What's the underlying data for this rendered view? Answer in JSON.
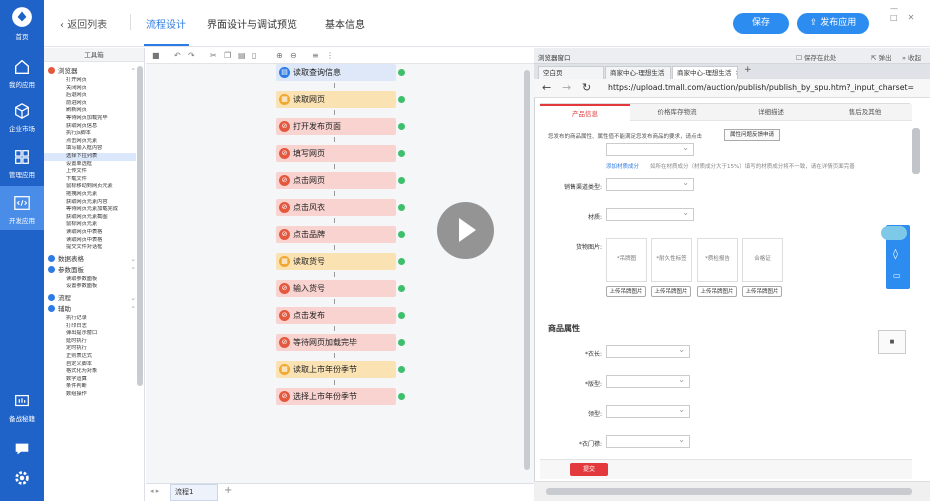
{
  "nav": {
    "home_label": "首页",
    "items": [
      {
        "label": "我的应用",
        "icon": "house-icon"
      },
      {
        "label": "企业市场",
        "icon": "cube-icon"
      },
      {
        "label": "管理应用",
        "icon": "grid-icon"
      },
      {
        "label": "开发应用",
        "icon": "code-icon",
        "active": true
      }
    ],
    "bottom_label": "备战秘籍",
    "chat_icon": "chat-icon",
    "settings_icon": "gear-icon",
    "colors": {
      "bg": "#1f62c8",
      "active": "#4a8de8"
    }
  },
  "header": {
    "back_label": "返回列表",
    "tabs": [
      "流程设计",
      "界面设计与调试预览",
      "基本信息"
    ],
    "save_label": "保存",
    "publish_label": "发布应用",
    "window_controls": [
      "—",
      "□",
      "✕"
    ],
    "accent": "#2d8cf0"
  },
  "toolbox": {
    "title": "工具箱",
    "groups": [
      {
        "name": "浏览器",
        "color": "#e4583e",
        "expanded": true,
        "items": [
          "打开网页",
          "关闭网页",
          "后退网页",
          "前进网页",
          "刷新网页",
          "等待网页加载完毕",
          "获取网页信息",
          "执行js脚本",
          "点击网页元素",
          "填写输入框内容",
          "选择下拉列表",
          "设置单选框",
          "上传文件",
          "下载文件",
          "鼠标移动到网页元素",
          "拖拽网页元素",
          "获取网页元素内容",
          "等待网页元素加载完成",
          "获取网页元素截图",
          "鼠标网页元素",
          "读取网页中表格",
          "读取网页中表格",
          "提交文件对话框"
        ]
      },
      {
        "name": "数据表格",
        "color": "#2d7be5",
        "expanded": false,
        "items": []
      },
      {
        "name": "参数面板",
        "color": "#2d7be5",
        "expanded": true,
        "items": [
          "读取参数面板",
          "设置参数面板"
        ]
      },
      {
        "name": "流程",
        "color": "#2d7be5",
        "expanded": false,
        "items": []
      },
      {
        "name": "辅助",
        "color": "#2d7be5",
        "expanded": true,
        "items": [
          "执行记录",
          "打印日志",
          "弹出提示窗口",
          "延时执行",
          "定时执行",
          "正则表达式",
          "自定义脚本",
          "格式化为对象",
          "数字运算",
          "条件判断",
          "数组操作"
        ]
      }
    ]
  },
  "canvas": {
    "toolbar_icons": [
      "camera-icon",
      "undo-icon",
      "redo-icon",
      "cut-icon",
      "copy-icon",
      "paste-icon",
      "delete-icon",
      "zoom-in-icon",
      "zoom-out-icon",
      "align-icon",
      "distribute-icon"
    ],
    "nodes": [
      {
        "label": "读取查询信息",
        "type": "info"
      },
      {
        "label": "读取网页",
        "type": "read"
      },
      {
        "label": "打开发布页面",
        "type": "browser"
      },
      {
        "label": "填写网页",
        "type": "browser"
      },
      {
        "label": "点击网页",
        "type": "browser"
      },
      {
        "label": "点击风衣",
        "type": "browser"
      },
      {
        "label": "点击品牌",
        "type": "browser"
      },
      {
        "label": "读取货号",
        "type": "read"
      },
      {
        "label": "输入货号",
        "type": "browser"
      },
      {
        "label": "点击发布",
        "type": "browser"
      },
      {
        "label": "等待网页加载完毕",
        "type": "browser"
      },
      {
        "label": "读取上市年份季节",
        "type": "read"
      },
      {
        "label": "选择上市年份季节",
        "type": "browser"
      }
    ],
    "flow_tab": "流程1",
    "add_tab": "+"
  },
  "browser": {
    "window_title": "浏览器窗口",
    "window_actions": [
      "弹出",
      "收起"
    ],
    "tabs": [
      "空白页",
      "商家中心-理想生活",
      "商家中心-理想生活"
    ],
    "url": "https://upload.tmall.com/auction/publish/publish_by_spu.htm?_input_charset=",
    "page_tabs": [
      "产品信息",
      "价格库存物流",
      "详细描述",
      "售后及其他"
    ],
    "notice": "您发布的商品属性、属性值不能满足您发布商品的要求，请点击",
    "notice_button": "属性问题反馈申请",
    "link_note": "添加材质成分",
    "fields": [
      "销售渠道类型:",
      "材质:",
      "货物图片:"
    ],
    "image_boxes": [
      "*吊牌图",
      "*耐久性标签",
      "*质检报告",
      "合格证"
    ],
    "upload_label": "上传吊牌图片",
    "section_title": "商品属性",
    "attr_fields": [
      "*衣长:",
      "*版型:",
      "领型:",
      "*衣门襟:"
    ],
    "submit_label": "提交",
    "accent": "#e4393c"
  }
}
